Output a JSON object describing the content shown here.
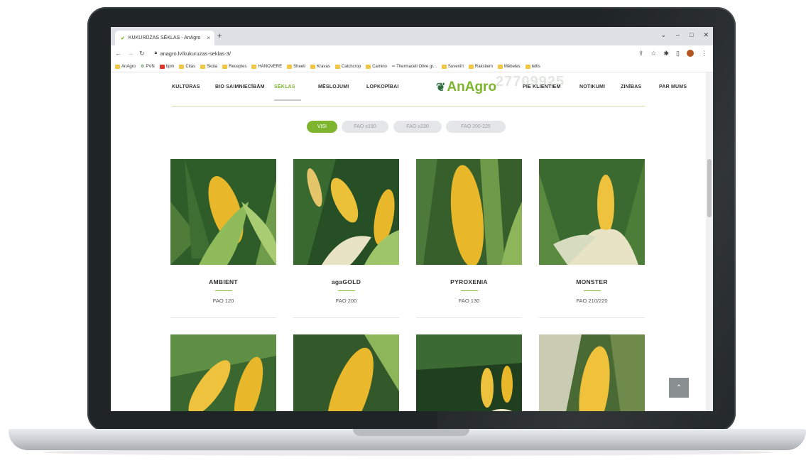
{
  "browser": {
    "tab_title": "KUKURŪZAS SĒKLAS - AnAgro",
    "tab_close": "×",
    "new_tab": "+",
    "url": "anagro.lv/kukuruzas-seklas-3/",
    "bookmarks": [
      "AnAgro",
      "PVN",
      "bpm",
      "Citas",
      "Skola",
      "Receptes",
      "HANOVERE",
      "Sheeti",
      "Kravas",
      "Catchcrop",
      "Camino",
      "Thermacell Olive gr...",
      "Suvenīri",
      "Rakstiem",
      "Mēbeles",
      "teltis"
    ]
  },
  "site": {
    "logo": "AnAgro",
    "phone": "27709925",
    "nav_left": [
      "KULTŪRAS",
      "BIO SAIMNIECĪBĀM",
      "SĒKLAS",
      "MĒSLOJUMI",
      "LOPKOPĪBAI"
    ],
    "nav_right": [
      "PIE KLIENTIEM",
      "NOTIKUMI",
      "ZINĪBAS",
      "PAR MUMS"
    ],
    "filters": [
      "VISI",
      "FAO ≤190",
      "FAO ≥230",
      "FAO 200-225"
    ]
  },
  "products": [
    {
      "name": "AMBIENT",
      "fao": "FAO 120"
    },
    {
      "name": "agaGOLD",
      "fao": "FAO 200"
    },
    {
      "name": "PYROXENIA",
      "fao": "FAO 130"
    },
    {
      "name": "MONSTER",
      "fao": "FAO 210/220"
    }
  ],
  "colors": {
    "accent": "#7db52e",
    "leaf_dark": "#2f5d2a",
    "leaf_light": "#7fa653",
    "kernel": "#e8b82a",
    "silk": "#e9e3c5"
  },
  "icons": {
    "back": "arrow-left-icon",
    "forward": "arrow-right-icon",
    "reload": "reload-icon",
    "lock": "lock-icon",
    "share": "share-icon",
    "star": "star-icon",
    "extensions": "puzzle-icon",
    "scroll_top": "chevron-up-icon"
  }
}
